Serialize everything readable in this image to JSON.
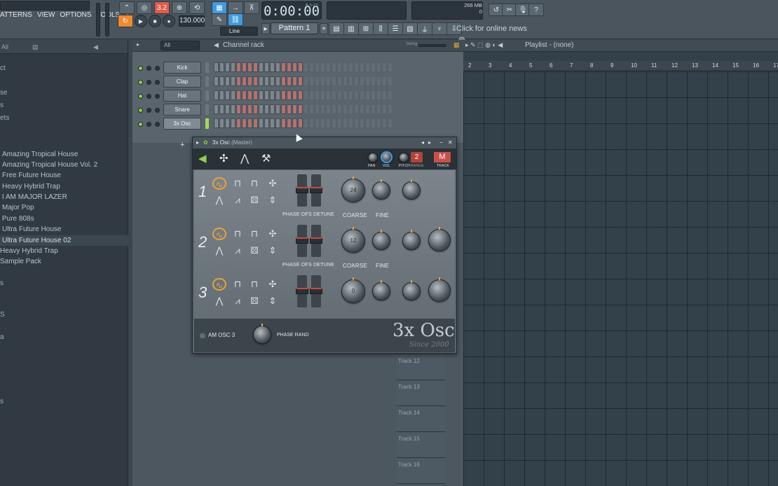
{
  "menu": [
    "ATTERNS",
    "VIEW",
    "OPTIONS",
    "TOOLS",
    "?"
  ],
  "transport": {
    "time": "0:00:00",
    "time_unit": "M:S:CS",
    "tempo": "130.000",
    "pattern": "Pattern 1",
    "snap": "Line",
    "memory": "266 MB",
    "mem_val_a": "0",
    "mem_val_b": "0",
    "pat_song": "3.2"
  },
  "news": "Click for online news",
  "browser": {
    "filter": "All",
    "fragments": [
      "ct",
      "se",
      "s",
      "ets"
    ],
    "items": [
      "Amazing Tropical House",
      "Amazing Tropical House Vol. 2",
      "Free Future House",
      "Heavy Hybrid Trap",
      "I AM MAJOR LAZER",
      "Major Pop",
      "Pure 808s",
      "Ultra Future House",
      "Ultra Future House 02",
      "Heavy Hybrid Trap",
      "Sample Pack"
    ],
    "selected_index": 8,
    "more_fragments": [
      "s",
      "S",
      "a",
      "s"
    ]
  },
  "channel_rack": {
    "filter": "All",
    "title": "Channel rack",
    "swing": "Swing",
    "channels": [
      {
        "name": "Kick",
        "selected": false
      },
      {
        "name": "Clap",
        "selected": false
      },
      {
        "name": "Hat",
        "selected": false
      },
      {
        "name": "Snare",
        "selected": false
      },
      {
        "name": "3x Osc",
        "selected": true
      }
    ],
    "add_button": "+"
  },
  "playlist": {
    "title": "Playlist - (none)",
    "ruler": [
      "2",
      "3",
      "4",
      "5",
      "6",
      "7",
      "8",
      "9",
      "10",
      "11",
      "12",
      "13",
      "14",
      "15",
      "16",
      "17"
    ],
    "tracks": [
      "Track 12",
      "Track 13",
      "Track 14",
      "Track 15",
      "Track 16"
    ]
  },
  "plugin": {
    "title": "3x Osc",
    "subtitle": "(Master)",
    "header_labels": [
      "PAN",
      "VOL",
      "PITCH",
      "RANGE",
      "TRACK"
    ],
    "range_value": "2",
    "track_badge": "M",
    "oscillators": [
      {
        "num": "1",
        "coarse": "24",
        "labels": [
          "PHASE OFS",
          "DETUNE",
          "COARSE",
          "FINE"
        ]
      },
      {
        "num": "2",
        "coarse": "12",
        "labels": [
          "PHASE OFS",
          "DETUNE",
          "COARSE",
          "FINE"
        ]
      },
      {
        "num": "3",
        "coarse": "0",
        "labels": []
      }
    ],
    "footer": {
      "am_osc": "AM OSC 3",
      "phase_rand": "PHASE RAND",
      "brand": "3x Osc",
      "since": "Since 2000"
    }
  },
  "colors": {
    "accent_orange": "#f08a2f",
    "accent_blue": "#3f9be0",
    "led_green": "#8fd14a",
    "step_red": "#b07270",
    "osc_orange": "#e9a23b"
  }
}
